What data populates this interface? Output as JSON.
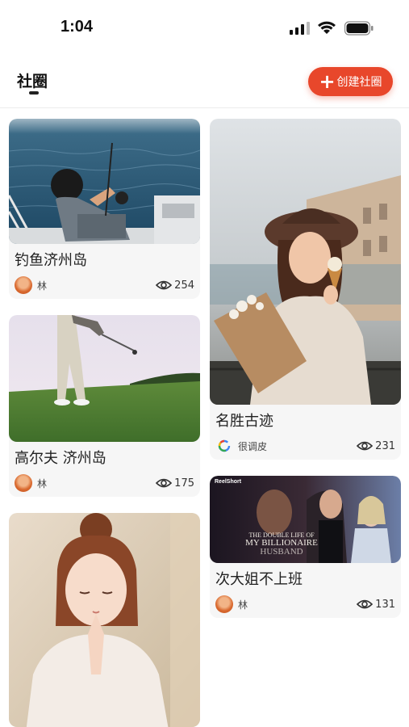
{
  "status_bar": {
    "time": "1:04"
  },
  "header": {
    "title": "社圈",
    "create_button": "创建社圈"
  },
  "colors": {
    "accent": "#e8472b",
    "card_bg": "#f6f6f6"
  },
  "cards": [
    {
      "title": "钓鱼济州岛",
      "author": "林",
      "views": "254",
      "image": "boy-fishing-on-boat",
      "avatar": "orange-avatar"
    },
    {
      "title": "名胜古迹",
      "author": "很调皮",
      "views": "231",
      "image": "woman-with-ice-cream-and-flowers",
      "avatar": "google-logo"
    },
    {
      "title": "高尔夫 济州岛",
      "author": "林",
      "views": "175",
      "image": "golfer-swing-on-grass",
      "avatar": "orange-avatar"
    },
    {
      "title": "次大姐不上班",
      "author": "林",
      "views": "131",
      "image": "drama-poster",
      "avatar": "orange-avatar",
      "poster_text": {
        "brand": "ReelShort",
        "headline_1": "THE DOUBLE LIFE OF",
        "headline_2": "MY BILLIONAIRE",
        "headline_3": "HUSBAND"
      }
    },
    {
      "title": "",
      "author": "",
      "views": "",
      "image": "praying-girl-illustration",
      "avatar": ""
    }
  ]
}
